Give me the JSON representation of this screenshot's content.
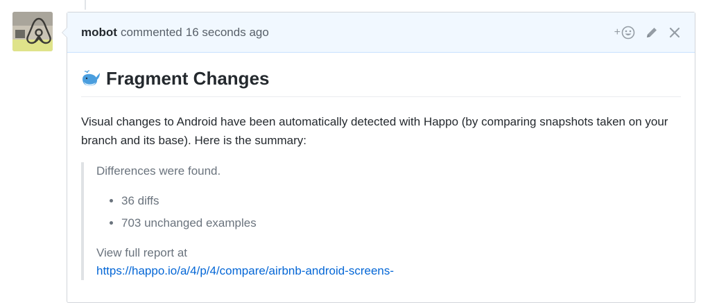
{
  "comment": {
    "author": "mobot",
    "action_text": "commented",
    "timestamp": "16 seconds ago",
    "reaction_plus": "+"
  },
  "body": {
    "heading": "Fragment Changes",
    "heading_emoji": "whale-icon",
    "intro": "Visual changes to Android have been automatically detected with Happo (by comparing snapshots taken on your branch and its base). Here is the summary:",
    "summary": {
      "status": "Differences were found.",
      "items": [
        "36 diffs",
        "703 unchanged examples"
      ],
      "report_label": "View full report at",
      "report_link": "https://happo.io/a/4/p/4/compare/airbnb-android-screens-"
    }
  },
  "colors": {
    "header_bg": "#f1f8ff",
    "link": "#0366d6",
    "border": "#d1d5da"
  }
}
